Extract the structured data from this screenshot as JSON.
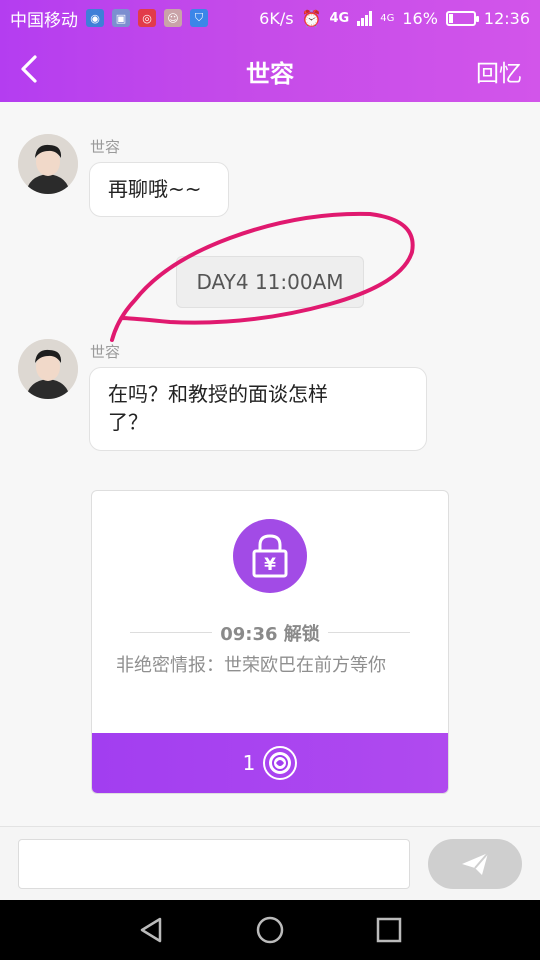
{
  "status_bar": {
    "carrier": "中国移动",
    "network_speed": "6K/s",
    "signal_a": "4G",
    "signal_b": "4G",
    "battery_percent": "16%",
    "battery_level": 0.16,
    "time": "12:36"
  },
  "header": {
    "title": "世容",
    "right_label": "回忆"
  },
  "messages": [
    {
      "sender": "世容",
      "text": "再聊哦~~"
    },
    {
      "sender": "世容",
      "text_line1": "在吗？和教授的面谈怎样",
      "text_line2": "了？"
    }
  ],
  "time_divider": "DAY4 11:00AM",
  "locked_card": {
    "lock_symbol": "¥",
    "unlock_time": "09:36 解锁",
    "description": "非绝密情报：世荣欧巴在前方等你",
    "price": "1"
  },
  "input": {
    "placeholder": ""
  },
  "colors": {
    "accent": "#a24be6",
    "annotation": "#e0196f"
  }
}
